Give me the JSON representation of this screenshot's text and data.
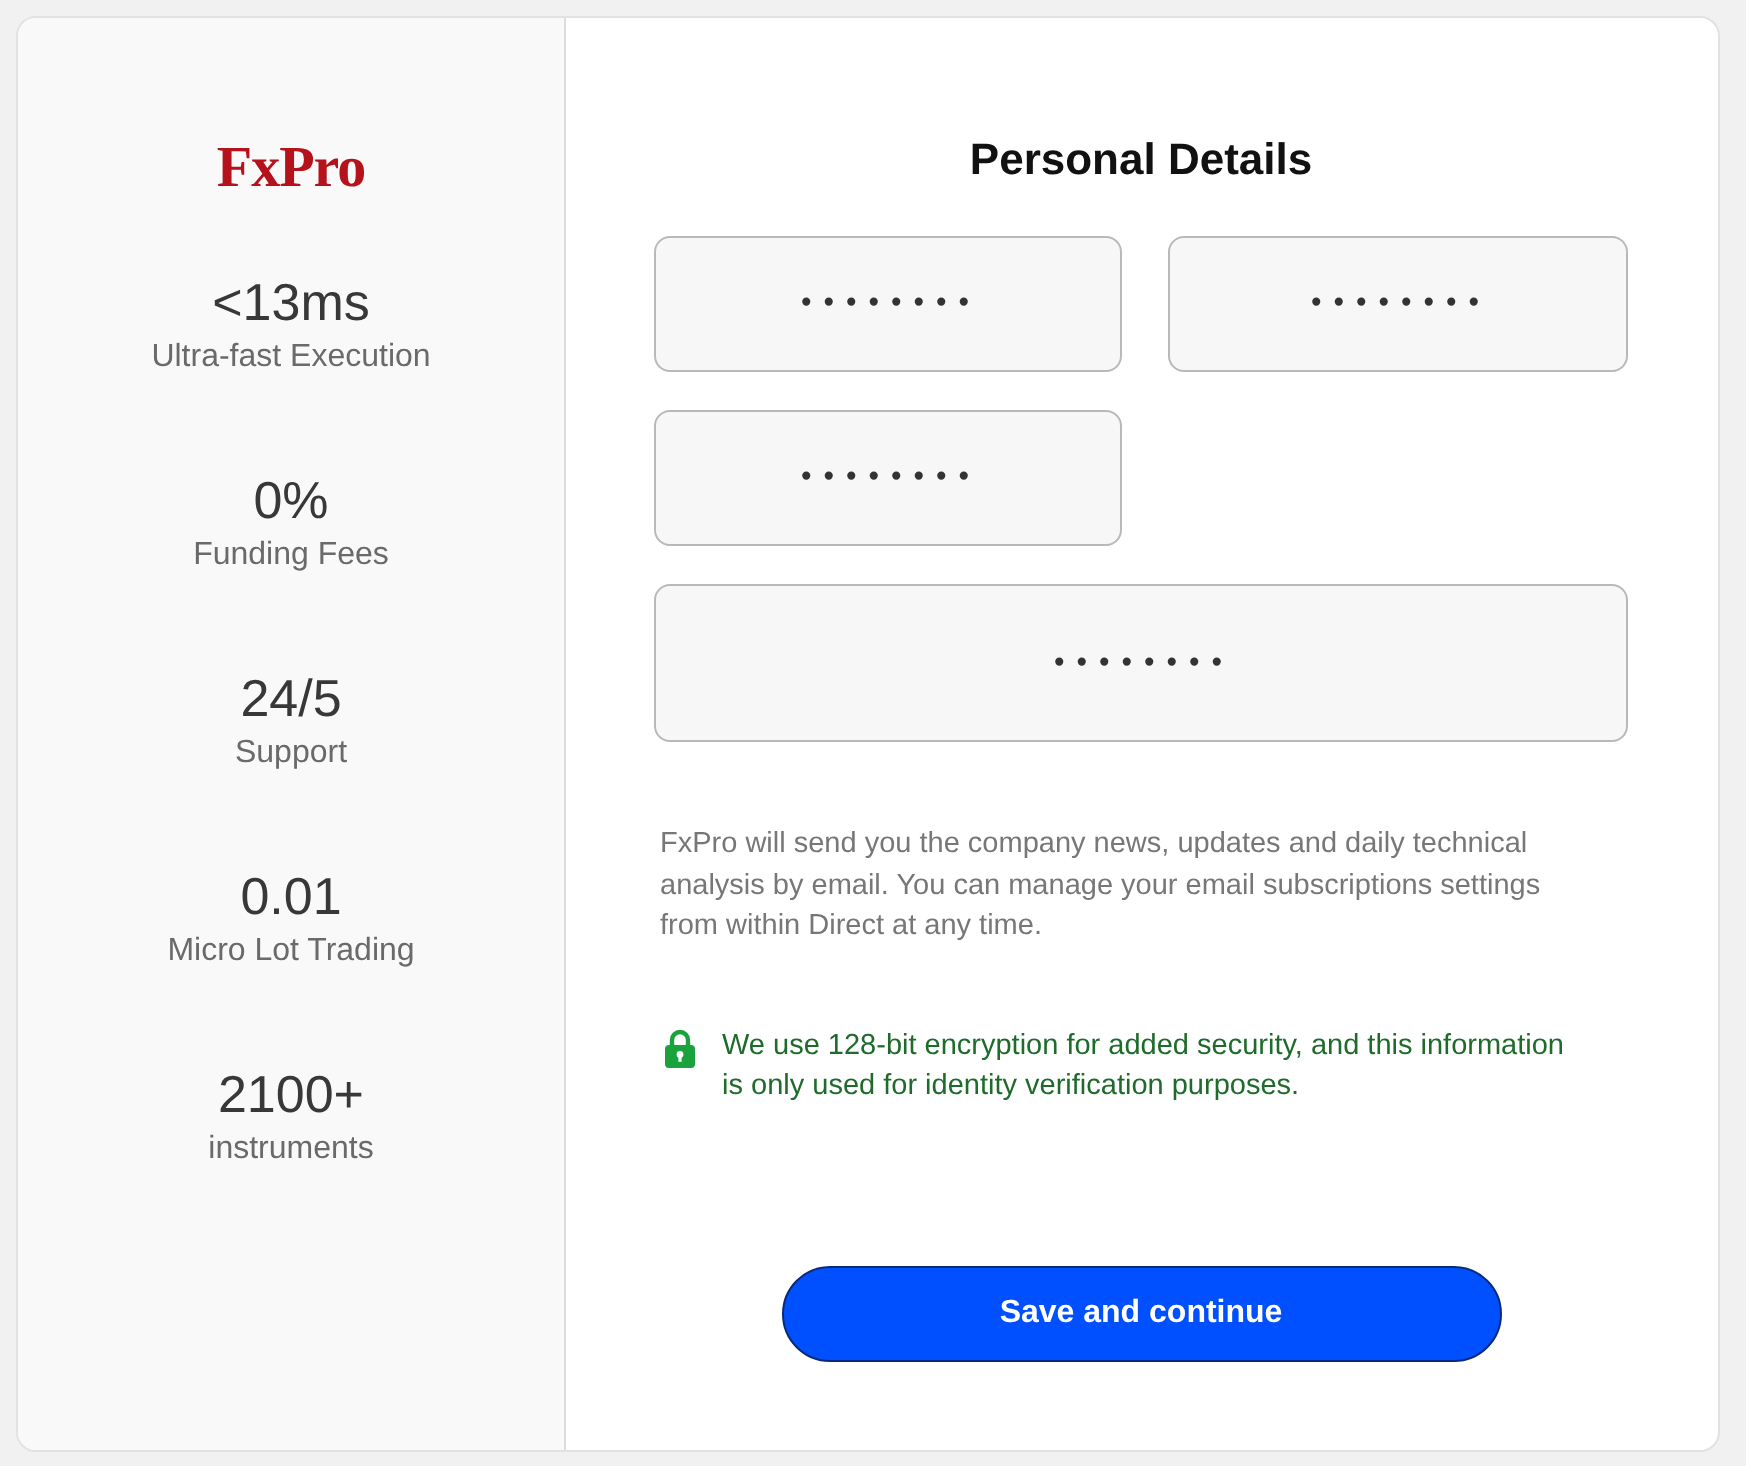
{
  "logo": {
    "text": "FxPro"
  },
  "stats": [
    {
      "value": "<13ms",
      "label": "Ultra-fast Execution"
    },
    {
      "value": "0%",
      "label": "Funding Fees"
    },
    {
      "value": "24/5",
      "label": "Support"
    },
    {
      "value": "0.01",
      "label": "Micro Lot Trading"
    },
    {
      "value": "2100+",
      "label": "instruments"
    }
  ],
  "form": {
    "title": "Personal Details",
    "fields": [
      {
        "kind": "half",
        "value": "••••••••"
      },
      {
        "kind": "half",
        "value": "••••••••"
      },
      {
        "kind": "half",
        "value": "••••••••"
      },
      {
        "kind": "full",
        "value": "••••••••"
      }
    ]
  },
  "notice": "FxPro will send you the company news, updates and daily technical analysis by email. You can manage your email subscriptions settings from within Direct at any time.",
  "security_note": {
    "text": "We use 128-bit encryption for added security, and this information is only used for identity verification purposes."
  },
  "buttons": [
    {
      "label": "Save and continue"
    }
  ]
}
